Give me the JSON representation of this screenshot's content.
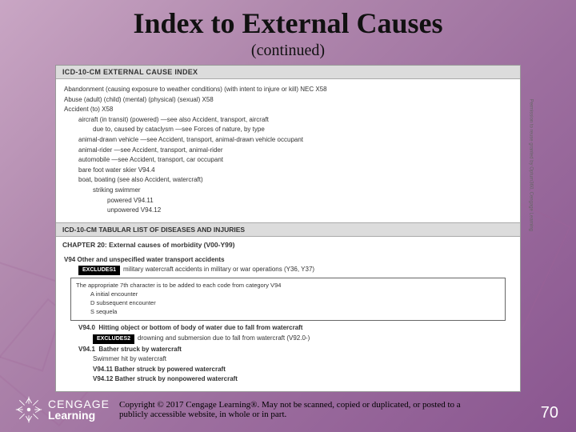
{
  "title": "Index to External Causes",
  "subtitle": "(continued)",
  "panel": {
    "header": "ICD-10-CM EXTERNAL CAUSE INDEX",
    "lines": [
      {
        "cls": "",
        "t": "Abandonment (causing exposure to weather conditions) (with intent to injure or kill) NEC X58"
      },
      {
        "cls": "",
        "t": "Abuse (adult) (child) (mental) (physical) (sexual) X58"
      },
      {
        "cls": "",
        "t": "Accident (to) X58"
      },
      {
        "cls": "i1",
        "t": "aircraft (in transit) (powered) —see also Accident, transport, aircraft"
      },
      {
        "cls": "i2",
        "t": "due to, caused by cataclysm —see Forces of nature, by type"
      },
      {
        "cls": "i1",
        "t": "animal-drawn vehicle —see Accident, transport, animal-drawn vehicle occupant"
      },
      {
        "cls": "i1",
        "t": "animal-rider —see Accident, transport, animal-rider"
      },
      {
        "cls": "i1",
        "t": "automobile —see Accident, transport, car occupant"
      },
      {
        "cls": "i1",
        "t": "bare foot water skier V94.4"
      },
      {
        "cls": "i1",
        "t": "boat, boating (see also Accident, watercraft)"
      },
      {
        "cls": "i2",
        "t": "striking swimmer"
      },
      {
        "cls": "i3",
        "t": "powered V94.11"
      },
      {
        "cls": "i3",
        "t": "unpowered V94.12"
      }
    ],
    "subheader": "ICD-10-CM TABULAR LIST OF DISEASES AND INJURIES",
    "chapter": "CHAPTER 20: External causes of morbidity (V00-Y99)",
    "v94": {
      "code": "V94",
      "title": "Other and unspecified water transport accidents"
    },
    "excludes1": {
      "tag": "EXCLUDES1",
      "text": "military watercraft accidents in military or war operations (Y36, Y37)"
    },
    "box": {
      "lead": "The appropriate 7th character is to be added to each code from category V94",
      "opts": [
        "A   initial encounter",
        "D   subsequent encounter",
        "S   sequela"
      ]
    },
    "v940": {
      "code": "V94.0",
      "title": "Hitting object or bottom of body of water due to fall from watercraft"
    },
    "excludes2": {
      "tag": "EXCLUDES2",
      "text": "drowning and submersion due to fall from watercraft (V92.0-)"
    },
    "v941": {
      "code": "V94.1",
      "title": "Bather struck by watercraft"
    },
    "sub1": "Swimmer hit by watercraft",
    "v9411": {
      "code": "V94.11",
      "title": "Bather struck by powered watercraft"
    },
    "v9412": {
      "code": "V94.12",
      "title": "Bather struck by nonpowered watercraft"
    },
    "sidecap": "Permission to reuse granted by Optum360, Cengage Learning"
  },
  "brand": {
    "top": "CENGAGE",
    "bot": "Learning"
  },
  "copyright": "Copyright © 2017 Cengage Learning®. May not be scanned, copied or duplicated, or posted to a publicly accessible website, in whole or in part.",
  "page": "70"
}
